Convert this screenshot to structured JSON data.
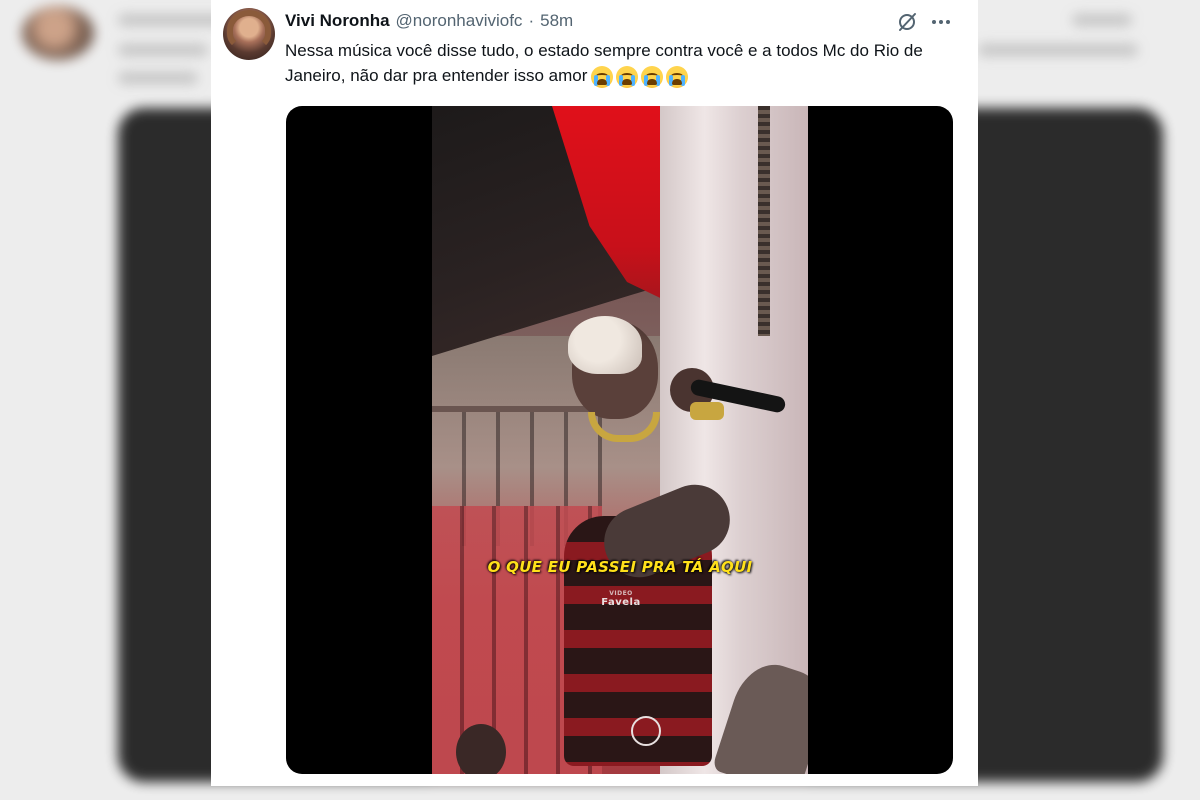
{
  "tweet": {
    "author_name": "Vivi Noronha",
    "author_handle": "@noronhaviviofc",
    "separator": "·",
    "time": "58m",
    "text": "Nessa música você disse tudo, o estado sempre contra você e a todos Mc do Rio de Janeiro, não dar pra entender isso amor",
    "emoji": [
      "loudly-crying-face",
      "loudly-crying-face",
      "loudly-crying-face",
      "loudly-crying-face"
    ],
    "icons": {
      "grok": "grok-icon",
      "more": "more-options-icon"
    }
  },
  "video": {
    "caption": "O QUE EU PASSEI PRA TÁ AQUI",
    "watermark_small": "VIDEO",
    "watermark": "Favela"
  },
  "colors": {
    "caption": "#ffe11a",
    "name": "#0f1419",
    "secondary": "#536471"
  }
}
